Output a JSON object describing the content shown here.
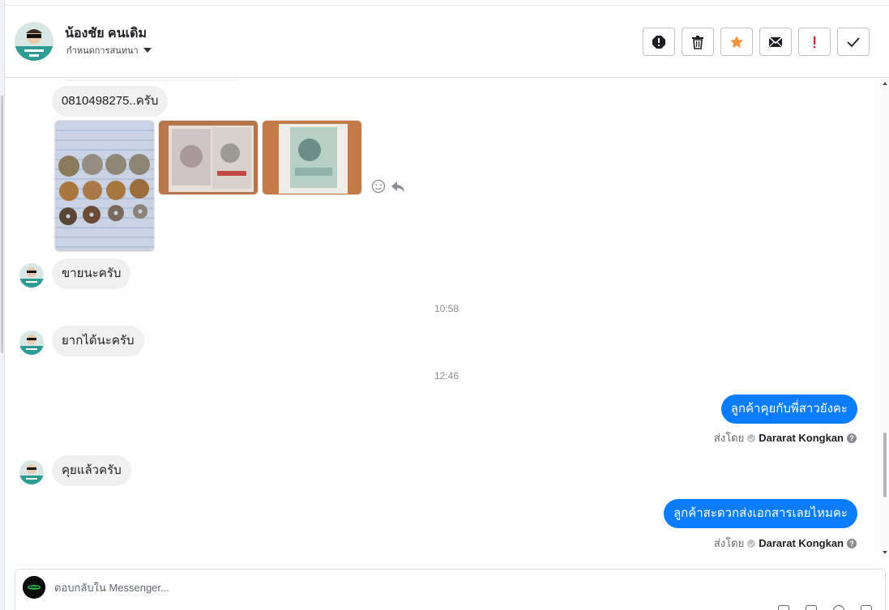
{
  "header": {
    "contact_name": "น้องชัย คนเดิม",
    "assign_label": "กำหนดการสนทนา",
    "actions": [
      {
        "name": "spam-icon"
      },
      {
        "name": "trash-icon"
      },
      {
        "name": "star-icon"
      },
      {
        "name": "mail-icon"
      },
      {
        "name": "follow-up-icon"
      },
      {
        "name": "done-icon"
      }
    ]
  },
  "messages": {
    "phone_text": "0810498275..ครับ",
    "sell_text": "ขายนะครับ",
    "time_1": "10:58",
    "want_text": "ยากได้นะครับ",
    "time_2": "12:46",
    "out_1": "ลูกค้าคุยกับพี่สาวยังคะ",
    "sent_by_label": "ส่งโดย",
    "sent_by_name": "Dararat Kongkan",
    "talked_text": "คุยแล้วครับ",
    "out_2": "ลูกค้าสะดวกส่งเอกสารเลยไหมคะ"
  },
  "reply": {
    "placeholder": "ตอบกลับใน Messenger..."
  },
  "colors": {
    "outgoing": "#0a7cff",
    "incoming": "#f0f0f0",
    "star": "#f7923a",
    "alert": "#e41e3f"
  }
}
